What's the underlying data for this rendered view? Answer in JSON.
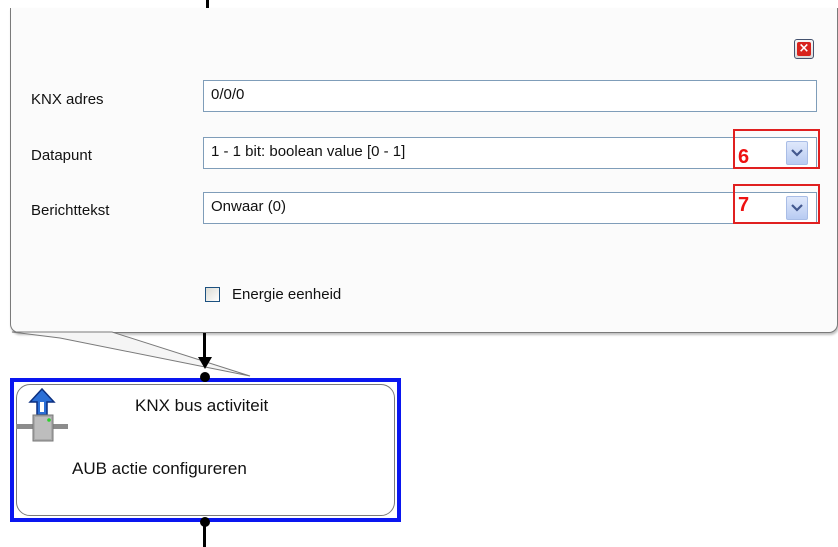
{
  "dialog": {
    "close_icon": "close-icon",
    "fields": [
      {
        "label": "KNX adres",
        "value": "0/0/0"
      },
      {
        "label": "Datapunt",
        "value": "1 - 1 bit: boolean value [0 - 1]",
        "marker": "6"
      },
      {
        "label": "Berichttekst",
        "value": "Onwaar (0)",
        "marker": "7"
      }
    ],
    "checkbox": {
      "label": "Energie eenheid",
      "checked": false
    }
  },
  "node": {
    "title": "KNX bus activiteit",
    "subtitle": "AUB actie configureren",
    "icon": "knx-bus-icon"
  },
  "colors": {
    "marker": "#e02020",
    "node_border": "#0a16f0",
    "close": "#d8231d"
  }
}
